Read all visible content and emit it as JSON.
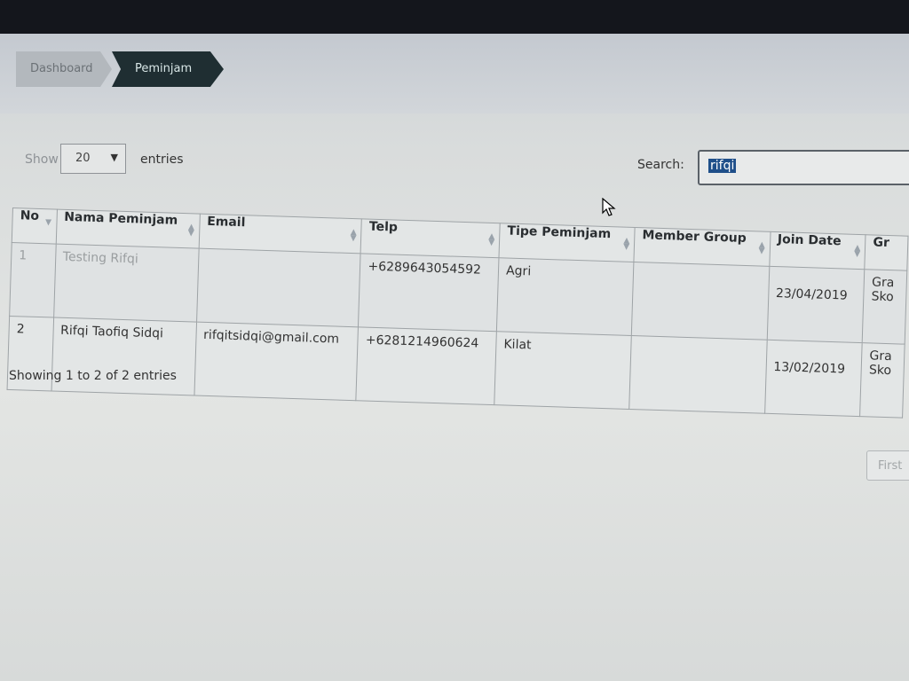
{
  "breadcrumb": {
    "items": [
      "Dashboard",
      "Peminjam"
    ]
  },
  "controls": {
    "show_label": "Show",
    "page_size": "20",
    "entries_label": "entries",
    "search_label": "Search:",
    "search_value": "rifqi"
  },
  "table": {
    "headers": [
      "No",
      "Nama Peminjam",
      "Email",
      "Telp",
      "Tipe Peminjam",
      "Member Group",
      "Join Date",
      "Gr"
    ],
    "rows": [
      [
        "1",
        "Testing Rifqi",
        "",
        "+6289643054592",
        "Agri",
        "",
        "23/04/2019",
        "Gra Sko"
      ],
      [
        "2",
        "Rifqi Taofiq Sidqi",
        "rifqitsidqi@gmail.com",
        "+6281214960624",
        "Kilat",
        "",
        "13/02/2019",
        "Gra Sko"
      ]
    ]
  },
  "footer": {
    "info": "Showing 1 to 2 of 2 entries",
    "first_button": "First"
  },
  "colors": {
    "breadcrumb_active": "#1f2e32",
    "search_highlight": "#1f4f8a"
  }
}
